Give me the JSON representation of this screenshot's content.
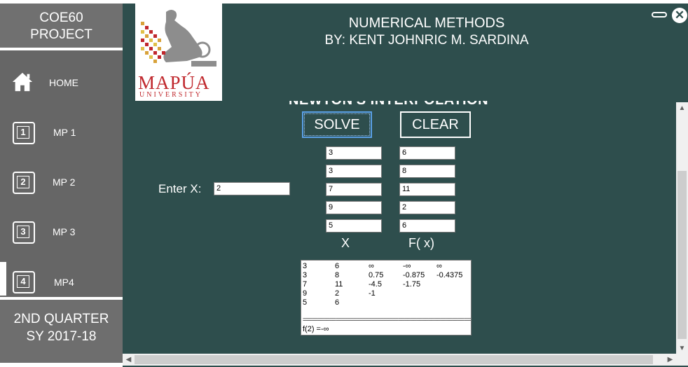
{
  "sidebar": {
    "brand_line1": "COE60",
    "brand_line2": "PROJECT",
    "items": [
      {
        "label": "HOME",
        "icon": "home-icon"
      },
      {
        "label": "MP 1",
        "icon": "number-1-icon",
        "num": "1"
      },
      {
        "label": "MP 2",
        "icon": "number-2-icon",
        "num": "2"
      },
      {
        "label": "MP 3",
        "icon": "number-3-icon",
        "num": "3"
      },
      {
        "label": "MP4",
        "icon": "number-4-icon",
        "num": "4"
      }
    ],
    "active_item": "MP4",
    "quarter_line1": "2ND QUARTER",
    "quarter_line2": "SY 2017-18"
  },
  "header": {
    "title": "NUMERICAL METHODS",
    "author": "BY: KENT JOHNRIC M. SARDINA",
    "logo_text": "MAPÚA",
    "logo_subtext": "UNIVERSITY"
  },
  "window_controls": {
    "minimize_icon": "minimize-icon",
    "close_icon": "close-icon",
    "close_glyph": "✕"
  },
  "form": {
    "section_title": "NEWTON'S INTERPOLATION",
    "solve_label": "SOLVE",
    "clear_label": "CLEAR",
    "enter_x_label": "Enter X:",
    "enter_x_value": "2",
    "x_values": [
      "3",
      "3",
      "7",
      "9",
      "5"
    ],
    "fx_values": [
      "6",
      "8",
      "11",
      "2",
      "6"
    ],
    "x_header": "X",
    "fx_header": "F( x)"
  },
  "output": {
    "rows": [
      [
        "3",
        "6",
        "∞",
        "-∞",
        "∞"
      ],
      [
        "3",
        "8",
        "0.75",
        "-0.875",
        "-0.4375"
      ],
      [
        "7",
        "11",
        "-4.5",
        "-1.75",
        ""
      ],
      [
        "9",
        "2",
        "-1",
        "",
        ""
      ],
      [
        "5",
        "6",
        "",
        "",
        ""
      ]
    ],
    "separator": "==========================================================",
    "result": "f(2) =-∞"
  },
  "colors": {
    "main_bg": "#2e4e4d",
    "sidebar_bg": "#666666",
    "logo_red": "#c0282d"
  }
}
